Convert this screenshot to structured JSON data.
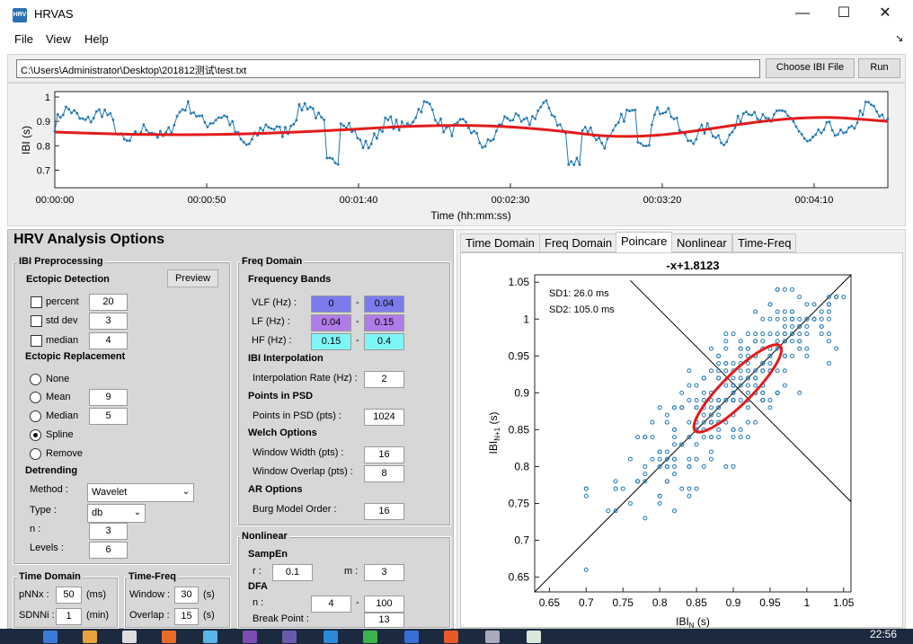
{
  "window": {
    "app_icon": "HRV",
    "title": "HRVAS",
    "minimize": "—",
    "maximize": "☐",
    "close": "✕",
    "resize_grip": "↘"
  },
  "menu": [
    "File",
    "View",
    "Help"
  ],
  "path": {
    "value": "C:\\Users\\Administrator\\Desktop\\201812测试\\test.txt",
    "choose_label": "Choose IBI File",
    "run_label": "Run"
  },
  "top_plot": {
    "ylabel": "IBI (s)",
    "xlabel": "Time (hh:mm:ss)",
    "yticks": [
      "1",
      "0.9",
      "0.8",
      "0.7"
    ],
    "xticks": [
      "00:00:00",
      "00:00:50",
      "00:01:40",
      "00:02:30",
      "00:03:20",
      "00:04:10"
    ],
    "line_color": "#1f77b4",
    "trend_color": "#e21b1b"
  },
  "options": {
    "title": "HRV Analysis Options",
    "ibi_pre": {
      "title": "IBI Preprocessing",
      "ectopic_detection": "Ectopic Detection",
      "preview": "Preview",
      "percent_label": "percent",
      "percent_value": "20",
      "stddev_label": "std dev",
      "stddev_value": "3",
      "median_label": "median",
      "median_value": "4",
      "ectopic_replacement": "Ectopic Replacement",
      "none_label": "None",
      "mean_label": "Mean",
      "mean_value": "9",
      "median2_label": "Median",
      "median2_value": "5",
      "spline_label": "Spline",
      "remove_label": "Remove",
      "detrending": "Detrending",
      "method_label": "Method :",
      "method_value": "Wavelet",
      "type_label": "Type :",
      "type_value": "db",
      "n_label": "n :",
      "n_value": "3",
      "levels_label": "Levels :",
      "levels_value": "6"
    },
    "freq": {
      "title": "Freq Domain",
      "bands_title": "Frequency Bands",
      "vlf_label": "VLF (Hz) :",
      "vlf_lo": "0",
      "vlf_hi": "0.04",
      "vlf_color": "#7b7bee",
      "lf_label": "LF (Hz) :",
      "lf_lo": "0.04",
      "lf_hi": "0.15",
      "lf_color": "#b07ce8",
      "hf_label": "HF (Hz) :",
      "hf_lo": "0.15",
      "hf_hi": "0.4",
      "hf_color": "#7ff6f6",
      "dash": "-",
      "interp_title": "IBI Interpolation",
      "interp_label": "Interpolation Rate (Hz) :",
      "interp_value": "2",
      "psd_title": "Points in PSD",
      "psd_label": "Points in PSD (pts) :",
      "psd_value": "1024",
      "welch_title": "Welch Options",
      "ww_label": "Window Width (pts) :",
      "ww_value": "16",
      "wo_label": "Window Overlap (pts) :",
      "wo_value": "8",
      "ar_title": "AR Options",
      "burg_label": "Burg Model Order :",
      "burg_value": "16"
    },
    "nonlinear": {
      "title": "Nonlinear",
      "sampen": "SampEn",
      "r_label": "r :",
      "r_value": "0.1",
      "m_label": "m :",
      "m_value": "3",
      "dfa": "DFA",
      "n_label": "n :",
      "n_lo": "4",
      "n_hi": "100",
      "bp_label": "Break Point :",
      "bp_value": "13"
    },
    "time_domain": {
      "title": "Time Domain",
      "pnnx_label": "pNNx :",
      "pnnx_value": "50",
      "pnnx_unit": "(ms)",
      "sdnni_label": "SDNNi :",
      "sdnni_value": "1",
      "sdnni_unit": "(min)"
    },
    "time_freq": {
      "title": "Time-Freq",
      "window_label": "Window :",
      "window_value": "30",
      "window_unit": "(s)",
      "overlap_label": "Overlap :",
      "overlap_value": "15",
      "overlap_unit": "(s)"
    }
  },
  "tabs": [
    "Time Domain",
    "Freq Domain",
    "Poincare",
    "Nonlinear",
    "Time-Freq"
  ],
  "active_tab": "Poincare",
  "chart_data": {
    "type": "scatter",
    "title": "-x+1.8123",
    "sd1": "SD1:   26.0 ms",
    "sd2": "SD2:   105.0 ms",
    "xlabel": "IBI_N (s)",
    "ylabel": "IBI_N+1 (s)",
    "xlim": [
      0.63,
      1.06
    ],
    "ylim": [
      0.63,
      1.06
    ],
    "xticks": [
      "0.65",
      "0.7",
      "0.75",
      "0.8",
      "0.85",
      "0.9",
      "0.95",
      "1",
      "1.05"
    ],
    "yticks": [
      "0.65",
      "0.7",
      "0.75",
      "0.8",
      "0.85",
      "0.9",
      "0.95",
      "1",
      "1.05"
    ],
    "identity_line": "y = x",
    "perpendicular_line": "y = -x + 1.8123",
    "ellipse": {
      "center": [
        0.906,
        0.906
      ],
      "sd1": 0.026,
      "sd2": 0.105
    },
    "marker_color": "#1f77b4",
    "ellipse_color": "#e21b1b"
  },
  "taskbar": {
    "clock": "22:56"
  }
}
